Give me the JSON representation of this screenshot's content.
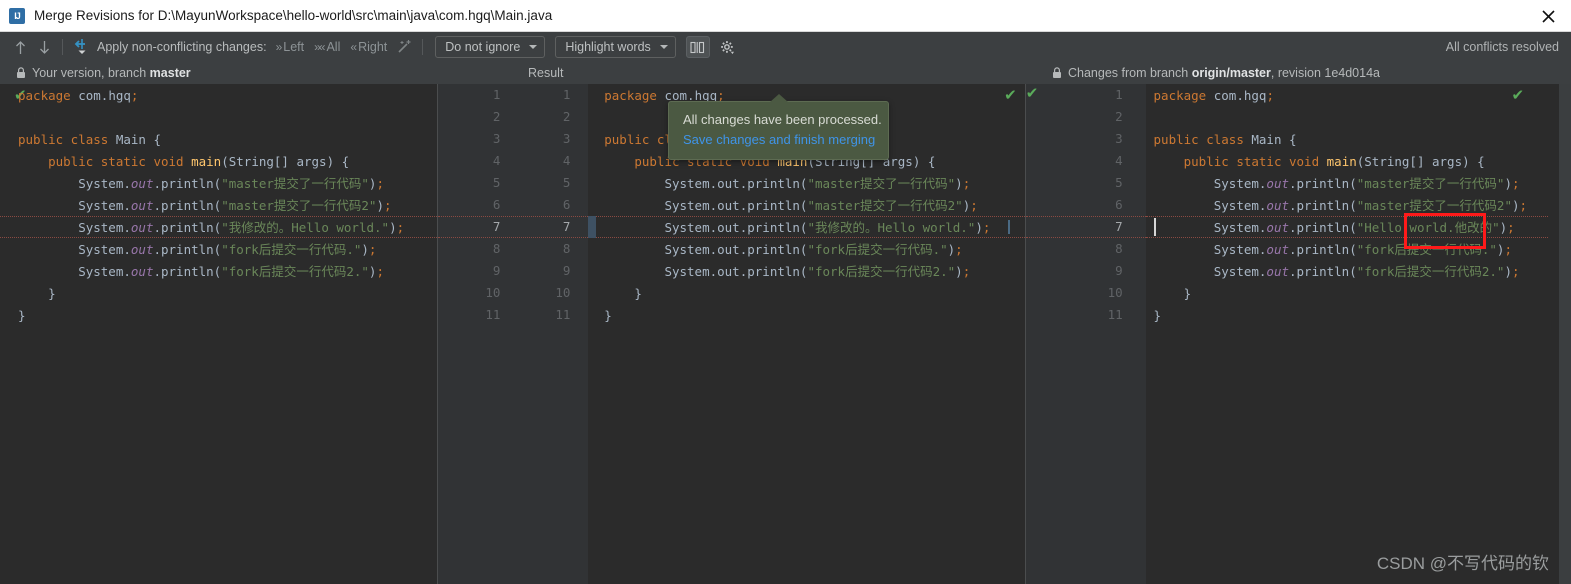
{
  "window": {
    "title": "Merge Revisions for D:\\MayunWorkspace\\hello-world\\src\\main\\java\\com.hgq\\Main.java",
    "app_icon": "intellij-idea-icon",
    "close_label": "×"
  },
  "toolbar": {
    "prev_change_icon": "arrow-up-icon",
    "next_change_icon": "arrow-down-icon",
    "apply_all_icon": "apply-all-nonconflicting-icon",
    "apply_label": "Apply non-conflicting changes:",
    "apply_left": "Left",
    "apply_all": "All",
    "apply_right": "Right",
    "magic_resolve_icon": "magic-wand-icon",
    "ignore_policy": "Do not ignore",
    "highlight_policy": "Highlight words",
    "columns_toggle_icon": "collapse-unchanged-icon",
    "settings_icon": "gear-icon",
    "status": "All conflicts resolved"
  },
  "panes": {
    "left": {
      "lock_icon": "lock-icon",
      "title_prefix": "Your version, branch ",
      "title_branch": "master",
      "ok_icon": "green-check-icon"
    },
    "middle": {
      "title": "Result",
      "ok_icon": "green-check-icon"
    },
    "right": {
      "lock_icon": "lock-icon",
      "title_prefix": "Changes from branch ",
      "title_branch": "origin/master",
      "title_suffix": ", revision ",
      "title_revision": "1e4d014a",
      "ok_icon": "green-check-icon"
    }
  },
  "gutters": {
    "left_numbers": [
      "1",
      "2",
      "3",
      "4",
      "5",
      "6",
      "7",
      "8",
      "9",
      "10",
      "11"
    ],
    "right_numbers": [
      "1",
      "2",
      "3",
      "4",
      "5",
      "6",
      "7",
      "8",
      "9",
      "10",
      "11"
    ],
    "far_right_numbers": [
      "1",
      "2",
      "3",
      "4",
      "5",
      "6",
      "7",
      "8",
      "9",
      "10",
      "11"
    ],
    "current_line": "7"
  },
  "code": {
    "left": [
      [
        {
          "t": "package ",
          "c": "kw"
        },
        {
          "t": "com.hgq",
          "c": "pl"
        },
        {
          "t": ";",
          "c": "semi"
        }
      ],
      [],
      [
        {
          "t": "public class ",
          "c": "kw"
        },
        {
          "t": "Main",
          "c": "cls"
        },
        {
          "t": " {",
          "c": "pl"
        }
      ],
      [
        {
          "t": "    public static ",
          "c": "kw"
        },
        {
          "t": "void ",
          "c": "kw"
        },
        {
          "t": "main",
          "c": "mth"
        },
        {
          "t": "(String[] args) {",
          "c": "pl"
        }
      ],
      [
        {
          "t": "        System.",
          "c": "pl"
        },
        {
          "t": "out",
          "c": "fld"
        },
        {
          "t": ".println(",
          "c": "pl"
        },
        {
          "t": "\"master提交了一行代码\"",
          "c": "str"
        },
        {
          "t": ")",
          "c": "pl"
        },
        {
          "t": ";",
          "c": "semi"
        }
      ],
      [
        {
          "t": "        System.",
          "c": "pl"
        },
        {
          "t": "out",
          "c": "fld"
        },
        {
          "t": ".println(",
          "c": "pl"
        },
        {
          "t": "\"master提交了一行代码2\"",
          "c": "str"
        },
        {
          "t": ")",
          "c": "pl"
        },
        {
          "t": ";",
          "c": "semi"
        }
      ],
      [
        {
          "t": "        System.",
          "c": "pl"
        },
        {
          "t": "out",
          "c": "fld"
        },
        {
          "t": ".println(",
          "c": "pl"
        },
        {
          "t": "\"我修改的。Hello world.\"",
          "c": "str"
        },
        {
          "t": ")",
          "c": "pl"
        },
        {
          "t": ";",
          "c": "semi"
        }
      ],
      [
        {
          "t": "        System.",
          "c": "pl"
        },
        {
          "t": "out",
          "c": "fld"
        },
        {
          "t": ".println(",
          "c": "pl"
        },
        {
          "t": "\"fork后提交一行代码.\"",
          "c": "str"
        },
        {
          "t": ")",
          "c": "pl"
        },
        {
          "t": ";",
          "c": "semi"
        }
      ],
      [
        {
          "t": "        System.",
          "c": "pl"
        },
        {
          "t": "out",
          "c": "fld"
        },
        {
          "t": ".println(",
          "c": "pl"
        },
        {
          "t": "\"fork后提交一行代码2.\"",
          "c": "str"
        },
        {
          "t": ")",
          "c": "pl"
        },
        {
          "t": ";",
          "c": "semi"
        }
      ],
      [
        {
          "t": "    }",
          "c": "pl"
        }
      ],
      [
        {
          "t": "}",
          "c": "pl"
        }
      ]
    ],
    "middle": [
      [
        {
          "t": "package ",
          "c": "kw"
        },
        {
          "t": "com.hgq",
          "c": "pl"
        },
        {
          "t": ";",
          "c": "semi"
        }
      ],
      [],
      [
        {
          "t": "public class ",
          "c": "kw"
        },
        {
          "t": "Main",
          "c": "cls"
        },
        {
          "t": " {",
          "c": "pl"
        }
      ],
      [
        {
          "t": "    public static ",
          "c": "kw"
        },
        {
          "t": "void ",
          "c": "kw"
        },
        {
          "t": "main",
          "c": "mth"
        },
        {
          "t": "(String[] args) {",
          "c": "pl"
        }
      ],
      [
        {
          "t": "        System.out.println(",
          "c": "pl"
        },
        {
          "t": "\"master提交了一行代码\"",
          "c": "str"
        },
        {
          "t": ")",
          "c": "pl"
        },
        {
          "t": ";",
          "c": "semi"
        }
      ],
      [
        {
          "t": "        System.out.println(",
          "c": "pl"
        },
        {
          "t": "\"master提交了一行代码2\"",
          "c": "str"
        },
        {
          "t": ")",
          "c": "pl"
        },
        {
          "t": ";",
          "c": "semi"
        }
      ],
      [
        {
          "t": "        System.out.println(",
          "c": "pl"
        },
        {
          "t": "\"我修改的。Hello world.\"",
          "c": "str"
        },
        {
          "t": ")",
          "c": "pl"
        },
        {
          "t": ";",
          "c": "semi"
        }
      ],
      [
        {
          "t": "        System.out.println(",
          "c": "pl"
        },
        {
          "t": "\"fork后提交一行代码.\"",
          "c": "str"
        },
        {
          "t": ")",
          "c": "pl"
        },
        {
          "t": ";",
          "c": "semi"
        }
      ],
      [
        {
          "t": "        System.out.println(",
          "c": "pl"
        },
        {
          "t": "\"fork后提交一行代码2.\"",
          "c": "str"
        },
        {
          "t": ")",
          "c": "pl"
        },
        {
          "t": ";",
          "c": "semi"
        }
      ],
      [
        {
          "t": "    }",
          "c": "pl"
        }
      ],
      [
        {
          "t": "}",
          "c": "pl"
        }
      ]
    ],
    "right": [
      [
        {
          "t": "package ",
          "c": "kw"
        },
        {
          "t": "com.hgq",
          "c": "pl"
        },
        {
          "t": ";",
          "c": "semi"
        }
      ],
      [],
      [
        {
          "t": "public class ",
          "c": "kw"
        },
        {
          "t": "Main",
          "c": "cls"
        },
        {
          "t": " {",
          "c": "pl"
        }
      ],
      [
        {
          "t": "    public static ",
          "c": "kw"
        },
        {
          "t": "void ",
          "c": "kw"
        },
        {
          "t": "main",
          "c": "mth"
        },
        {
          "t": "(String[] args) {",
          "c": "pl"
        }
      ],
      [
        {
          "t": "        System.",
          "c": "pl"
        },
        {
          "t": "out",
          "c": "fld"
        },
        {
          "t": ".println(",
          "c": "pl"
        },
        {
          "t": "\"master提交了一行代码\"",
          "c": "str"
        },
        {
          "t": ")",
          "c": "pl"
        },
        {
          "t": ";",
          "c": "semi"
        }
      ],
      [
        {
          "t": "        System.",
          "c": "pl"
        },
        {
          "t": "out",
          "c": "fld"
        },
        {
          "t": ".println(",
          "c": "pl"
        },
        {
          "t": "\"master提交了一行代码2\"",
          "c": "str"
        },
        {
          "t": ")",
          "c": "pl"
        },
        {
          "t": ";",
          "c": "semi"
        }
      ],
      [
        {
          "t": "        System.",
          "c": "pl"
        },
        {
          "t": "out",
          "c": "fld"
        },
        {
          "t": ".println(",
          "c": "pl"
        },
        {
          "t": "\"Hello world.他改的\"",
          "c": "str"
        },
        {
          "t": ")",
          "c": "pl"
        },
        {
          "t": ";",
          "c": "semi"
        }
      ],
      [
        {
          "t": "        System.",
          "c": "pl"
        },
        {
          "t": "out",
          "c": "fld"
        },
        {
          "t": ".println(",
          "c": "pl"
        },
        {
          "t": "\"fork后提交一行代码.\"",
          "c": "str"
        },
        {
          "t": ")",
          "c": "pl"
        },
        {
          "t": ";",
          "c": "semi"
        }
      ],
      [
        {
          "t": "        System.",
          "c": "pl"
        },
        {
          "t": "out",
          "c": "fld"
        },
        {
          "t": ".println(",
          "c": "pl"
        },
        {
          "t": "\"fork后提交一行代码2.\"",
          "c": "str"
        },
        {
          "t": ")",
          "c": "pl"
        },
        {
          "t": ";",
          "c": "semi"
        }
      ],
      [
        {
          "t": "    }",
          "c": "pl"
        }
      ],
      [
        {
          "t": "}",
          "c": "pl"
        }
      ]
    ]
  },
  "tooltip": {
    "line1": "All changes have been processed.",
    "link": "Save changes and finish merging"
  },
  "annotation": {
    "color": "#ff1a1a"
  },
  "watermark": "CSDN @不写代码的钦",
  "colors": {
    "background": "#3c3f41",
    "editor_bg": "#2b2b2b",
    "gutter_bg": "#313335",
    "keyword": "#cc7832",
    "string": "#6a8759",
    "field": "#9876aa",
    "method": "#ffc66d",
    "plain": "#a9b7c6",
    "tooltip_bg": "#4b5942",
    "link": "#3f94e8",
    "change_marker": "#3e5163",
    "dotted_change": "#8a4a42"
  }
}
